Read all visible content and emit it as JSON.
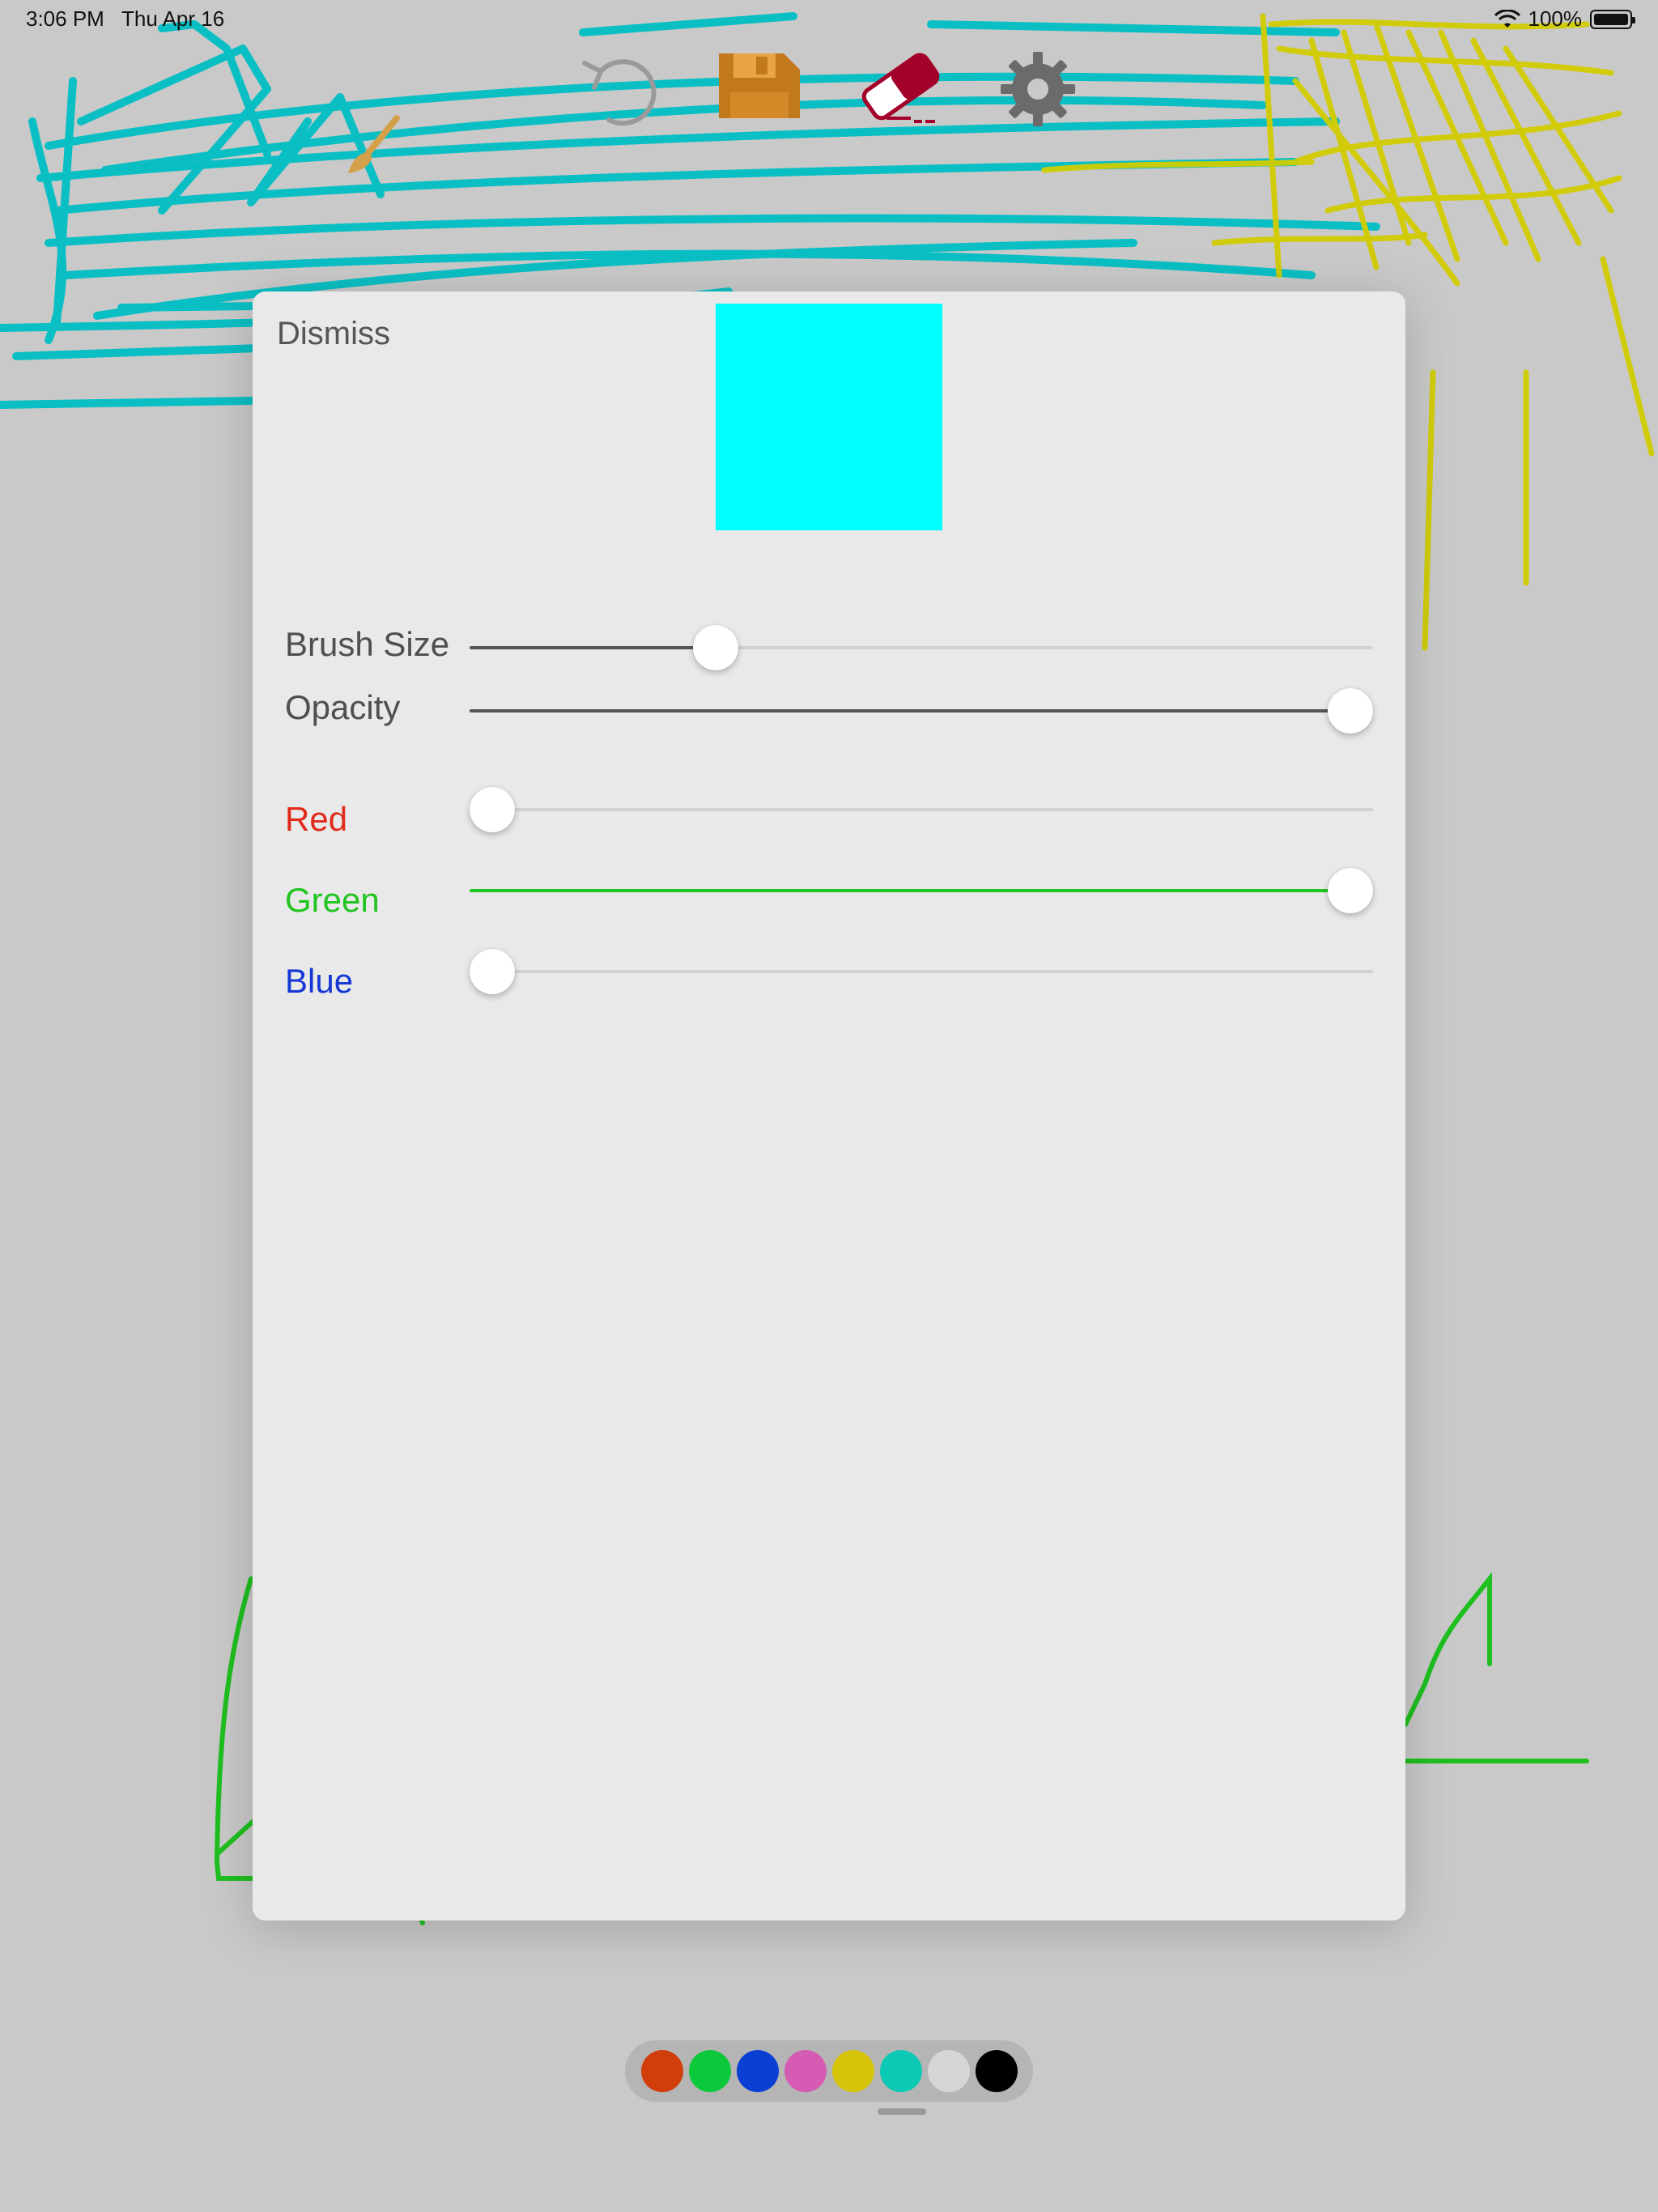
{
  "status": {
    "time": "3:06 PM",
    "date": "Thu Apr 16",
    "battery": "100%"
  },
  "toolbar": {
    "brush": "brush-icon",
    "undo": "undo-icon",
    "save": "save-icon",
    "eraser": "eraser-icon",
    "settings": "gear-icon",
    "colors": {
      "brush": "#d4a04a",
      "undo": "#9a9a9a",
      "save": "#c2791c",
      "eraser": "#a3002a",
      "gear": "#6b6b6b"
    }
  },
  "panel": {
    "dismiss_label": "Dismiss",
    "preview_color": "#00ffff",
    "sliders": [
      {
        "key": "brush_size",
        "label": "Brush Size",
        "value": 0.26,
        "label_color": "#4f4f4f",
        "fill_color": "#555555"
      },
      {
        "key": "opacity",
        "label": "Opacity",
        "value": 1.0,
        "label_color": "#4f4f4f",
        "fill_color": "#555555"
      },
      {
        "key": "red",
        "label": "Red",
        "value": 0.0,
        "label_color": "#e02a1a",
        "fill_color": "#e02a1a"
      },
      {
        "key": "green",
        "label": "Green",
        "value": 1.0,
        "label_color": "#1fc41f",
        "fill_color": "#1fc41f"
      },
      {
        "key": "blue",
        "label": "Blue",
        "value": 0.0,
        "label_color": "#1537d4",
        "fill_color": "#1537d4"
      }
    ]
  },
  "palette": {
    "colors": [
      "#d23d0c",
      "#0bc93b",
      "#0b3fd4",
      "#d65cb3",
      "#d6c40b",
      "#0bc9b5",
      "#d6d6d6",
      "#000000"
    ]
  }
}
